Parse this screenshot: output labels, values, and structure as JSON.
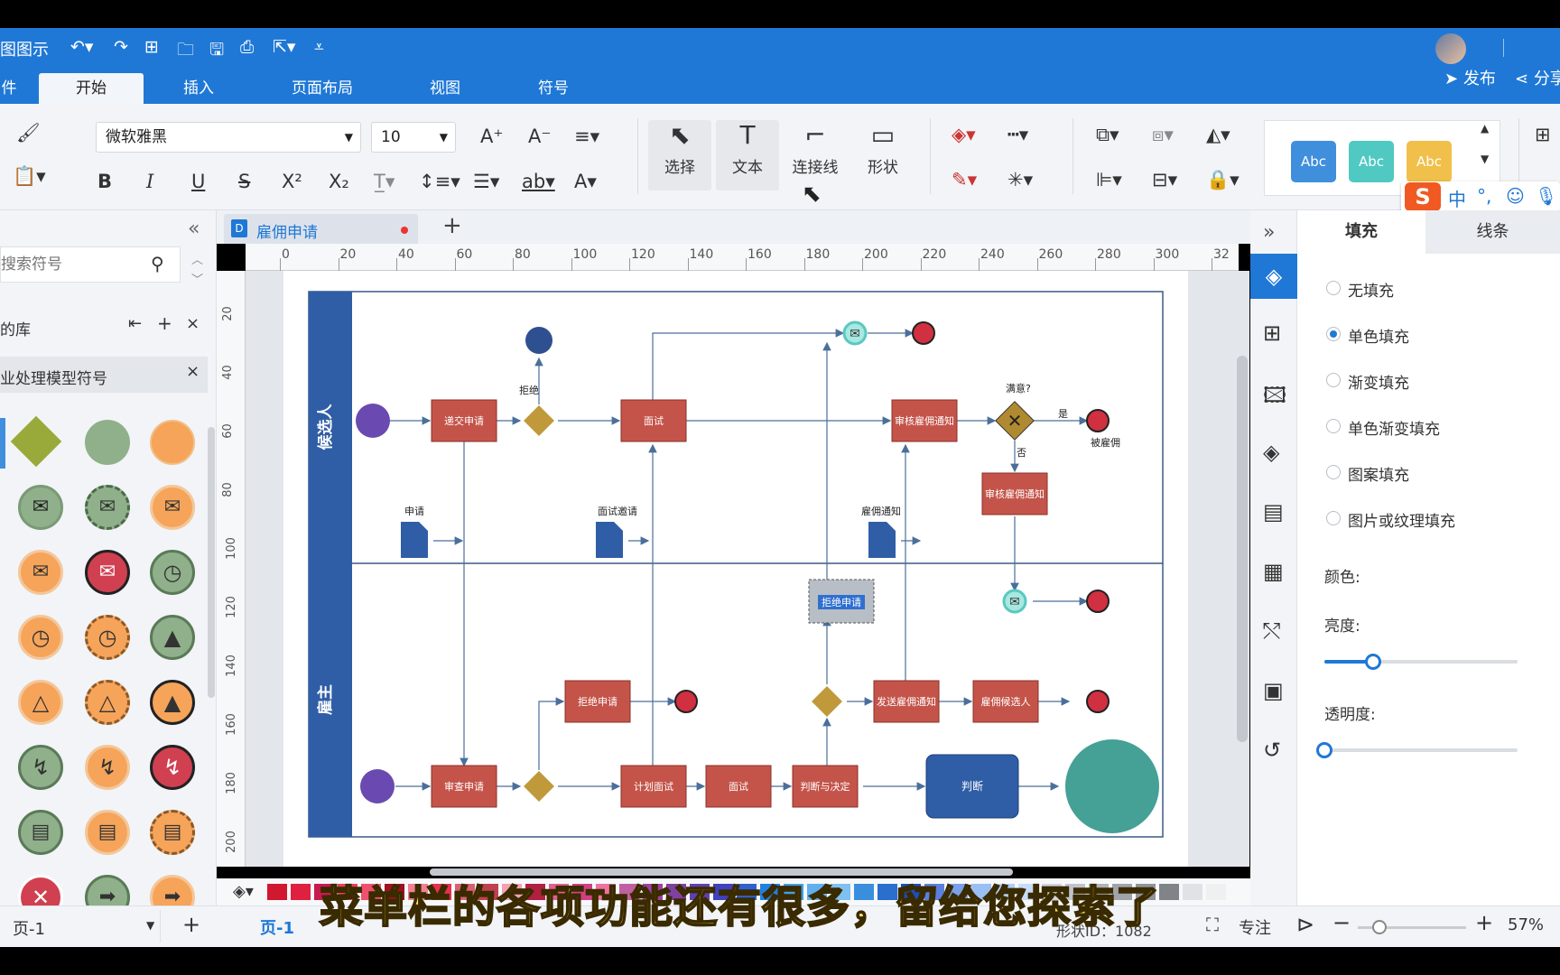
{
  "app": {
    "title": "图图示",
    "publish": "发布",
    "share": "分享"
  },
  "tabs": [
    {
      "label": "件"
    },
    {
      "label": "开始"
    },
    {
      "label": "插入"
    },
    {
      "label": "页面布局"
    },
    {
      "label": "视图"
    },
    {
      "label": "符号"
    }
  ],
  "ribbon": {
    "font_name": "微软雅黑",
    "font_size": "10",
    "tools": {
      "select": "选择",
      "text": "文本",
      "connector": "连接线",
      "shape": "形状"
    },
    "style_buttons": [
      {
        "label": "Abc",
        "color": "#3f8fdd"
      },
      {
        "label": "Abc",
        "color": "#4fc9c1"
      },
      {
        "label": "Abc",
        "color": "#f0c04a"
      }
    ],
    "ime": {
      "chinese": "中"
    }
  },
  "left_panel": {
    "search_placeholder": "搜索符号",
    "library_label": "的库",
    "category": "业处理模型符号"
  },
  "document": {
    "tab_name": "雇佣申请"
  },
  "ruler": {
    "h": [
      "0",
      "20",
      "40",
      "60",
      "80",
      "100",
      "120",
      "140",
      "160",
      "180",
      "200",
      "220",
      "240",
      "260",
      "280",
      "300",
      "32"
    ],
    "v": [
      "20",
      "40",
      "60",
      "80",
      "100",
      "120",
      "140",
      "160",
      "180",
      "200"
    ]
  },
  "diagram": {
    "lane1": "候选人",
    "lane2": "雇主",
    "nodes": {
      "submit": "递交申请",
      "interview": "面试",
      "review_notice": "审核雇佣通知",
      "review_notice2": "审核雇佣通知",
      "reject_app": "拒绝申请",
      "reject_app_selected": "拒绝申请",
      "send_notice": "发送雇佣通知",
      "hire": "雇佣候选人",
      "review_app": "审查申请",
      "plan_interview": "计划面试",
      "interview2": "面试",
      "judge_decide": "判断与决定",
      "judge": "判断"
    },
    "labels": {
      "reject": "拒绝",
      "satisfied": "满意?",
      "yes": "是",
      "no": "否",
      "hired": "被雇佣",
      "doc_apply": "申请",
      "doc_invite": "面试邀请",
      "doc_notice": "雇佣通知"
    }
  },
  "right_panel": {
    "tabs": {
      "fill": "填充",
      "line": "线条"
    },
    "options": [
      {
        "label": "无填充",
        "selected": false
      },
      {
        "label": "单色填充",
        "selected": true
      },
      {
        "label": "渐变填充",
        "selected": false
      },
      {
        "label": "单色渐变填充",
        "selected": false
      },
      {
        "label": "图案填充",
        "selected": false
      },
      {
        "label": "图片或纹理填充",
        "selected": false
      }
    ],
    "color_label": "颜色:",
    "brightness_label": "亮度:",
    "brightness_value": 0.25,
    "opacity_label": "透明度:",
    "opacity_value": 0
  },
  "status": {
    "page_select": "页-1",
    "page_tab": "页-1",
    "shape_id": "形状ID：1082",
    "focus": "专注",
    "zoom": "57%",
    "zoom_value": 0.2
  },
  "subtitle": "菜单栏的各项功能还有很多，留给您探索了"
}
